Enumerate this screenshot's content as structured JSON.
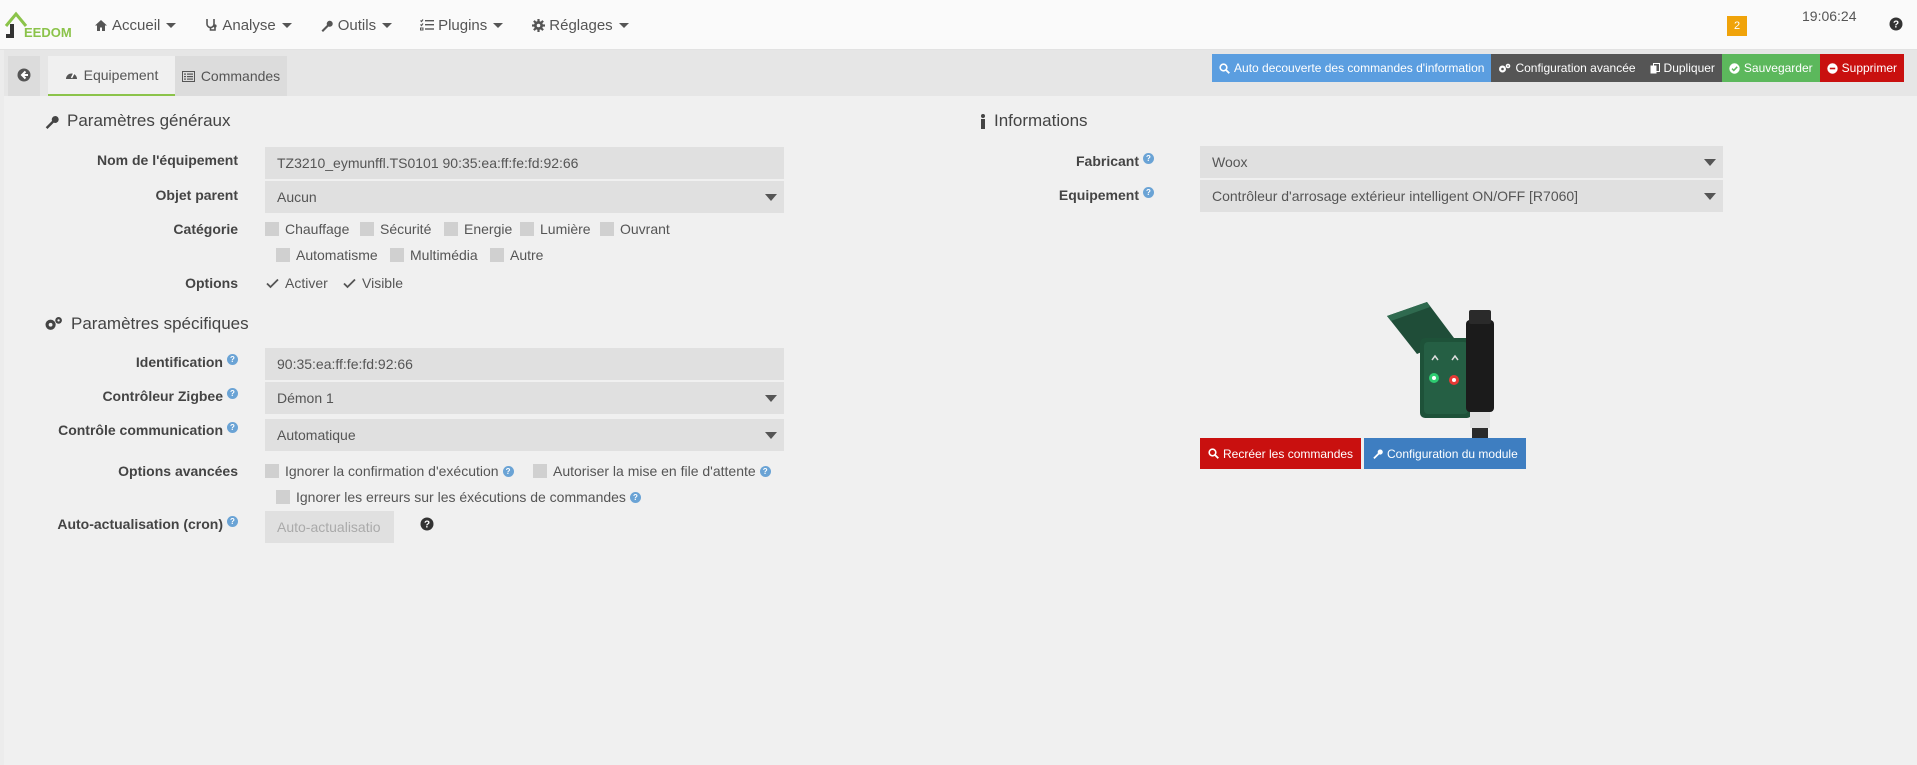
{
  "navbar": {
    "logo_text": "EEDOM",
    "menu": [
      {
        "label": "Accueil",
        "icon": "home-icon"
      },
      {
        "label": "Analyse",
        "icon": "stethoscope-icon"
      },
      {
        "label": "Outils",
        "icon": "wrench-icon"
      },
      {
        "label": "Plugins",
        "icon": "tasks-icon"
      },
      {
        "label": "Réglages",
        "icon": "gear-icon"
      }
    ],
    "notif_count": "2",
    "clock": "19:06:24",
    "help_icon": "question-circle-icon"
  },
  "tabs": {
    "back_icon": "arrow-circle-left-icon",
    "equipement": "Equipement",
    "commandes": "Commandes"
  },
  "actions": {
    "auto_discovery": "Auto decouverte des commandes d'information",
    "advanced_config": "Configuration avancée",
    "duplicate": "Dupliquer",
    "save": "Sauvegarder",
    "delete": "Supprimer",
    "colors": {
      "auto": "#5b9ee0",
      "advanced": "#555555",
      "duplicate": "#555555",
      "save": "#5cb85c",
      "delete": "#c9100f"
    }
  },
  "general": {
    "title": "Paramètres généraux",
    "name_label": "Nom de l'équipement",
    "name_value": "TZ3210_eymunffl.TS0101 90:35:ea:ff:fe:fd:92:66",
    "parent_label": "Objet parent",
    "parent_value": "Aucun",
    "category_label": "Catégorie",
    "categories": [
      "Chauffage",
      "Sécurité",
      "Energie",
      "Lumière",
      "Ouvrant",
      "Automatisme",
      "Multimédia",
      "Autre"
    ],
    "options_label": "Options",
    "options": [
      "Activer",
      "Visible"
    ]
  },
  "specific": {
    "title": "Paramètres spécifiques",
    "identification_label": "Identification",
    "identification_value": "90:35:ea:ff:fe:fd:92:66",
    "controller_label": "Contrôleur Zigbee",
    "controller_value": "Démon 1",
    "comm_label": "Contrôle communication",
    "comm_value": "Automatique",
    "advanced_label": "Options avancées",
    "advanced_options": [
      "Ignorer la confirmation d'exécution",
      "Autoriser la mise en file d'attente",
      "Ignorer les erreurs sur les éxécutions de commandes"
    ],
    "cron_label": "Auto-actualisation (cron)",
    "cron_placeholder": "Auto-actualisatio"
  },
  "informations": {
    "title": "Informations",
    "manufacturer_label": "Fabricant",
    "manufacturer_value": "Woox",
    "equipment_label": "Equipement",
    "equipment_value": "Contrôleur d'arrosage extérieur intelligent ON/OFF [R7060]",
    "recreate_button": "Recréer les commandes",
    "module_config_button": "Configuration du module"
  }
}
